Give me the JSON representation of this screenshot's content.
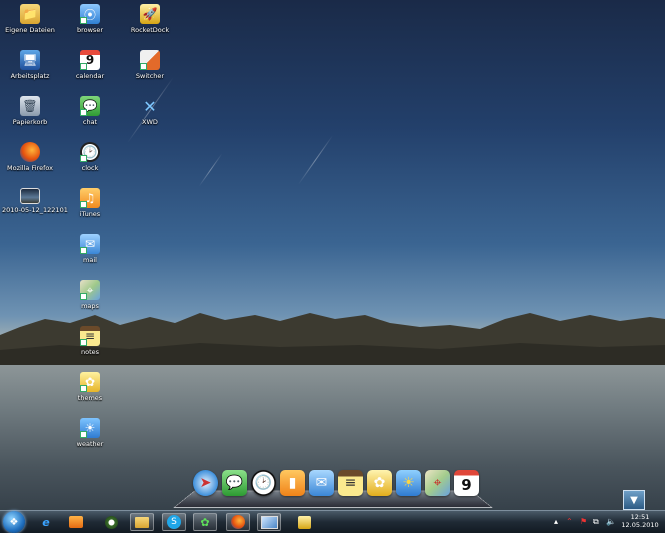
{
  "desktop_icons": [
    {
      "label": "Eigene Dateien",
      "icon": "folder-icon"
    },
    {
      "label": "Arbeitsplatz",
      "icon": "computer-icon"
    },
    {
      "label": "Papierkorb",
      "icon": "recycle-bin-icon"
    },
    {
      "label": "Mozilla Firefox",
      "icon": "firefox-icon"
    },
    {
      "label": "2010-05-12_122101",
      "icon": "screenshot-file-icon"
    },
    {
      "label": "browser",
      "icon": "browser-icon"
    },
    {
      "label": "calendar",
      "icon": "calendar-icon"
    },
    {
      "label": "chat",
      "icon": "chat-icon"
    },
    {
      "label": "clock",
      "icon": "clock-icon"
    },
    {
      "label": "iTunes",
      "icon": "itunes-icon"
    },
    {
      "label": "mail",
      "icon": "mail-icon"
    },
    {
      "label": "maps",
      "icon": "maps-icon"
    },
    {
      "label": "notes",
      "icon": "notes-icon"
    },
    {
      "label": "themes",
      "icon": "themes-icon"
    },
    {
      "label": "weather",
      "icon": "weather-icon"
    },
    {
      "label": "RocketDock",
      "icon": "rocketdock-icon"
    },
    {
      "label": "Switcher",
      "icon": "switcher-icon"
    },
    {
      "label": "XWD",
      "icon": "xwd-icon"
    }
  ],
  "dock": {
    "calendar_day": "9",
    "items": [
      "safari-icon",
      "messages-icon",
      "clock-icon",
      "ipod-icon",
      "mail-icon",
      "notes-icon",
      "photos-icon",
      "weather-icon",
      "maps-icon",
      "calendar-icon"
    ]
  },
  "taskbar": {
    "items": [
      "internet-explorer-icon",
      "media-player-icon",
      "media-center-icon",
      "explorer-folder-icon",
      "skype-icon",
      "icq-icon",
      "firefox-icon",
      "switcher-icon",
      "rocketdock-icon"
    ]
  },
  "clock": {
    "time": "12:51",
    "date": "12.05.2010"
  },
  "colors": {
    "taskbar": "#1f2a35",
    "sky_top": "#1a2a48",
    "horizon": "#d9c8a8"
  }
}
